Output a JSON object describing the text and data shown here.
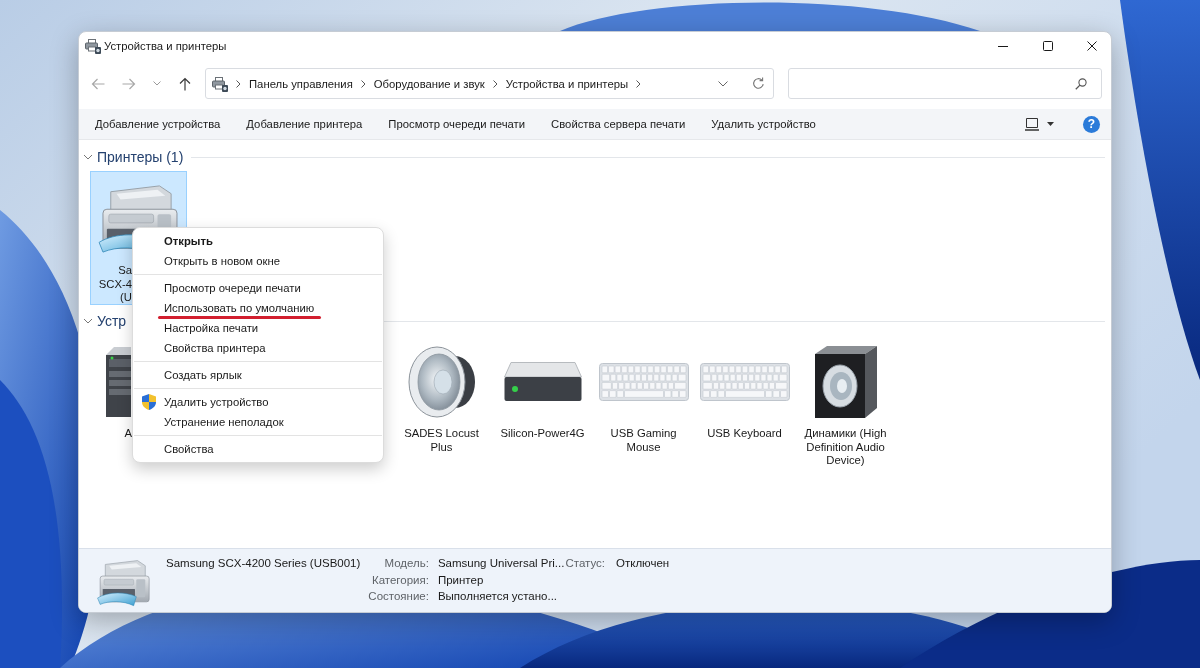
{
  "window": {
    "title": "Устройства и принтеры"
  },
  "navigation": {
    "buttons": [
      {
        "kind": "back",
        "disabled": true
      },
      {
        "kind": "forward",
        "disabled": true
      },
      {
        "kind": "up",
        "disabled": false
      }
    ],
    "breadcrumbs": [
      "Панель управления",
      "Оборудование и звук",
      "Устройства и принтеры"
    ]
  },
  "toolbar": {
    "commands": [
      "Добавление устройства",
      "Добавление принтера",
      "Просмотр очереди печати",
      "Свойства сервера печати",
      "Удалить устройство"
    ],
    "help": "?"
  },
  "groups": [
    {
      "title": "Принтеры (1)",
      "expanded": true,
      "items": [
        {
          "kind": "printer",
          "label": "Sa SCX-4 (U",
          "selected": true
        }
      ]
    },
    {
      "title": "Устр",
      "expanded": true,
      "items": [
        {
          "kind": "computer",
          "label": "A",
          "selected": false
        },
        {
          "kind": "speaker",
          "label": "SADES Locust Plus",
          "selected": false
        },
        {
          "kind": "drive",
          "label": "Silicon-Power4G",
          "selected": false
        },
        {
          "kind": "keyboard",
          "label": "USB Gaming Mouse",
          "selected": false
        },
        {
          "kind": "keyboard",
          "label": "USB Keyboard",
          "selected": false
        },
        {
          "kind": "speaker-box",
          "label": "Динамики (High Definition Audio Device)",
          "selected": false
        }
      ]
    }
  ],
  "context_menu": {
    "sections": [
      {
        "items": [
          {
            "label": "Открыть",
            "kind": "plain",
            "default": true,
            "underlined": false
          },
          {
            "label": "Открыть в новом окне",
            "kind": "plain",
            "default": false,
            "underlined": false
          }
        ]
      },
      {
        "items": [
          {
            "label": "Просмотр очереди печати",
            "kind": "plain",
            "default": false,
            "underlined": false
          },
          {
            "label": "Использовать по умолчанию",
            "kind": "plain",
            "default": false,
            "underlined": true
          },
          {
            "label": "Настройка печати",
            "kind": "plain",
            "default": false,
            "underlined": false
          },
          {
            "label": "Свойства принтера",
            "kind": "plain",
            "default": false,
            "underlined": false
          }
        ]
      },
      {
        "items": [
          {
            "label": "Создать ярлык",
            "kind": "plain",
            "default": false,
            "underlined": false
          }
        ]
      },
      {
        "items": [
          {
            "label": "Удалить устройство",
            "kind": "shield",
            "default": false,
            "underlined": false
          },
          {
            "label": "Устранение неполадок",
            "kind": "plain",
            "default": false,
            "underlined": false
          }
        ]
      },
      {
        "items": [
          {
            "label": "Свойства",
            "kind": "plain",
            "default": false,
            "underlined": false
          }
        ]
      }
    ]
  },
  "details": {
    "name": "Samsung SCX-4200 Series (USB001)",
    "columns": [
      {
        "properties": [
          {
            "label": "Модель:",
            "value": "Samsung Universal Pri..."
          },
          {
            "label": "Категория:",
            "value": "Принтер"
          },
          {
            "label": "Состояние:",
            "value": "Выполняется устано..."
          }
        ]
      },
      {
        "properties": [
          {
            "label": "Статус:",
            "value": "Отключен"
          }
        ]
      }
    ]
  }
}
